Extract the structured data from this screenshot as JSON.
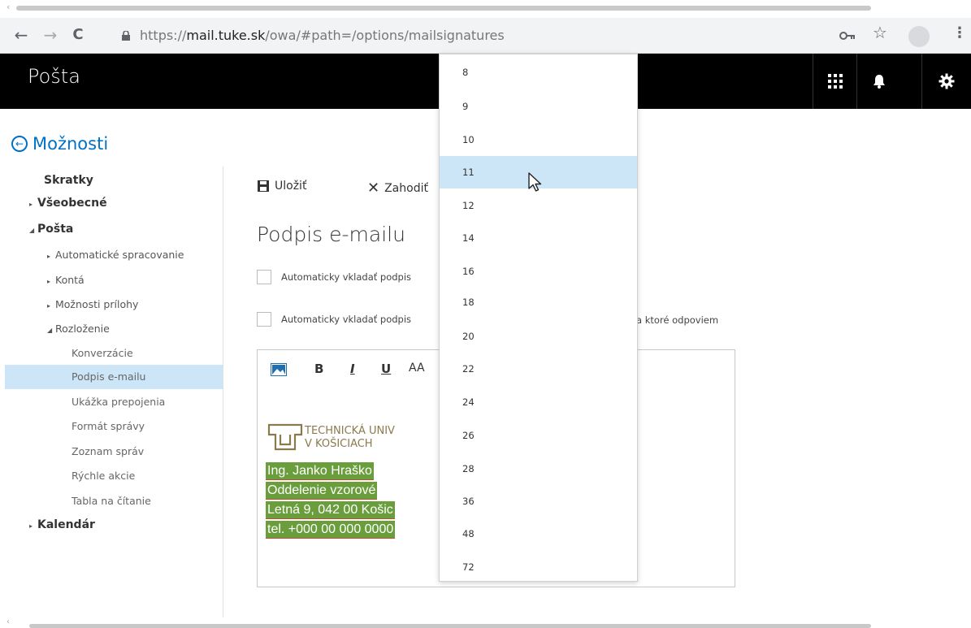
{
  "browser": {
    "scroll_arrow": "‹",
    "back": "←",
    "forward": "→",
    "reload": "C",
    "url_scheme": "https://",
    "url_host": "mail.tuke.sk",
    "url_path": "/owa/#path=/options/mailsignatures",
    "star": "☆",
    "menu": "⋮"
  },
  "header": {
    "title": "Pošta"
  },
  "nav": {
    "back_label": "Možnosti",
    "items": [
      {
        "label": "Skratky"
      },
      {
        "label": "Všeobecné"
      },
      {
        "label": "Pošta"
      },
      {
        "label": "Automatické spracovanie"
      },
      {
        "label": "Kontá"
      },
      {
        "label": "Možnosti prílohy"
      },
      {
        "label": "Rozloženie"
      },
      {
        "label": "Konverzácie"
      },
      {
        "label": "Podpis e-mailu"
      },
      {
        "label": "Ukážka prepojenia"
      },
      {
        "label": "Formát správy"
      },
      {
        "label": "Zoznam správ"
      },
      {
        "label": "Rýchle akcie"
      },
      {
        "label": "Tabla na čítanie"
      },
      {
        "label": "Kalendár"
      }
    ]
  },
  "content": {
    "save_label": "Uložiť",
    "discard_label": "Zahodiť",
    "page_title": "Podpis e-mailu",
    "checkbox1_label": "Automaticky vkladať podpis",
    "checkbox2_label": "Automaticky vkladať podpis",
    "checkbox2_tail": "a ktoré odpoviem"
  },
  "editor": {
    "bold": "B",
    "italic": "I",
    "underline": "U",
    "font_size": "AA",
    "logo_line1": "TECHNICKÁ UNIV",
    "logo_line2": "V KOŠICIACH",
    "signature": [
      "Ing. Janko Hraško",
      "Oddelenie vzorové",
      "Letná 9, 042 00 Košic",
      "tel. +000 00 000 0000"
    ]
  },
  "font_size_dropdown": {
    "options": [
      "8",
      "9",
      "10",
      "11",
      "12",
      "14",
      "16",
      "18",
      "20",
      "22",
      "24",
      "26",
      "28",
      "36",
      "48",
      "72"
    ],
    "hovered": "11"
  },
  "colors": {
    "accent": "#0072c6",
    "header_bg": "#000000",
    "selection": "#cde6f7",
    "signature_highlight": "#6a9e3c"
  }
}
